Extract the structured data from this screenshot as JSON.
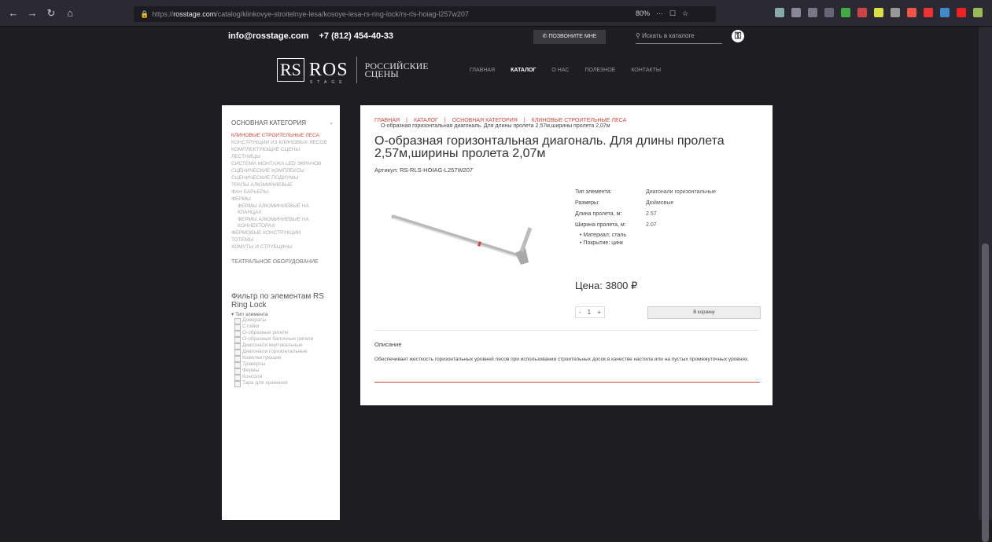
{
  "browser": {
    "url_prefix": "https://",
    "url_host": "rosstage.com",
    "url_path": "/catalog/klinkovye-stroitelnye-lesa/kosoye-lesa-rs-ring-lock/rs-rls-hoiag-l257w207",
    "zoom": "80%",
    "menu_dots": "···"
  },
  "topbar": {
    "email": "info@rosstage.com",
    "phone": "+7 (812) 454-40-33",
    "callback_label": "ПОЗВОНИТЕ МНЕ",
    "search_placeholder": "Искать в каталоге"
  },
  "logo": {
    "rs": "RS",
    "ros": "ROS",
    "stage": "STAGE",
    "name": "РОССИЙСКИЕ СЦЕНЫ"
  },
  "nav": [
    "ГЛАВНАЯ",
    "КАТАЛОГ",
    "О НАС",
    "ПОЛЕЗНОЕ",
    "КОНТАКТЫ"
  ],
  "sidebar": {
    "heading": "ОСНОВНАЯ КАТЕГОРИЯ",
    "items": [
      "КЛИНОВЫЕ СТРОИТЕЛЬНЫЕ ЛЕСА",
      "КОНСТРУКЦИИ ИЗ КЛИНОВЫХ ЛЕСОВ",
      "КОМПЛЕКТУЮЩИЕ СЦЕНЫ",
      "ЛЕСТНИЦЫ",
      "СИСТЕМА МОНТАЖА LED ЭКРАНОВ",
      "СЦЕНИЧЕСКИЕ КОМПЛЕКСЫ",
      "СЦЕНИЧЕСКИЕ ПОДИУМЫ",
      "ТРАПЫ АЛЮМИНИЕВЫЕ",
      "ФАН БАРЬЕРЫ",
      "ФЕРМЫ"
    ],
    "subitems": [
      "ФЕРМЫ АЛЮМИНИЕВЫЕ НА КЛАНЦАХ",
      "ФЕРМЫ АЛЮМИНИЕВЫЕ НА КОННЕКТОРАХ"
    ],
    "items2": [
      "ФЕРМОВЫЕ КОНСТРУКЦИИ",
      "ТОТЕМЫ",
      "ХОМУТЫ И СТРУБЦИНЫ"
    ],
    "heading2": "ТЕАТРАЛЬНОЕ ОБОРУДОВАНИЕ",
    "filter_title": "Фильтр по элементам RS Ring Lock",
    "filter_group": "Тип элемента",
    "filters": [
      "Домкраты",
      "Стойки",
      "О-образные ригели",
      "О-образные балочные ригели",
      "Диагонали вертикальные",
      "Диагонали горизонтальные",
      "Комплектующие",
      "Траверсы",
      "Фермы",
      "Консоли",
      "Тара для хранения"
    ]
  },
  "product": {
    "breadcrumbs": [
      "ГЛАВНАЯ",
      "КАТАЛОГ",
      "ОСНОВНАЯ КАТЕГОРИЯ",
      "КЛИНОВЫЕ СТРОИТЕЛЬНЫЕ ЛЕСА"
    ],
    "breadcrumb_current": "О-образная горизонтальная диагональ. Для длины пролета 2,57м,ширины пролета 2,07м",
    "title": "О-образная горизонтальная диагональ. Для длины пролета 2,57м,ширины пролета 2,07м",
    "sku": "Артикул: RS-RLS-HOIAG-L257W207",
    "props": [
      {
        "k": "Тип элемента:",
        "v": "Диагонали горизонтальные"
      },
      {
        "k": "Размеры:",
        "v": "Дюймовые"
      },
      {
        "k": "Длина пролета, м:",
        "v": "2.57"
      },
      {
        "k": "Ширина пролета, м:",
        "v": "2.07"
      }
    ],
    "features": [
      "Материал: сталь",
      "Покрытие: цинк"
    ],
    "price": "Цена: 3800 ₽",
    "qty": "1",
    "qty_minus": "-",
    "qty_plus": "+",
    "cart_label": "В корзину",
    "desc_head": "Описание",
    "desc": "Обеспечивает жесткость горизонтальных уровней лесов при использовании строительных досок в качестве настила или на пустых промежуточных уровнях."
  },
  "colors": {
    "accent": "#d9463c",
    "bg": "#1e1d21"
  }
}
